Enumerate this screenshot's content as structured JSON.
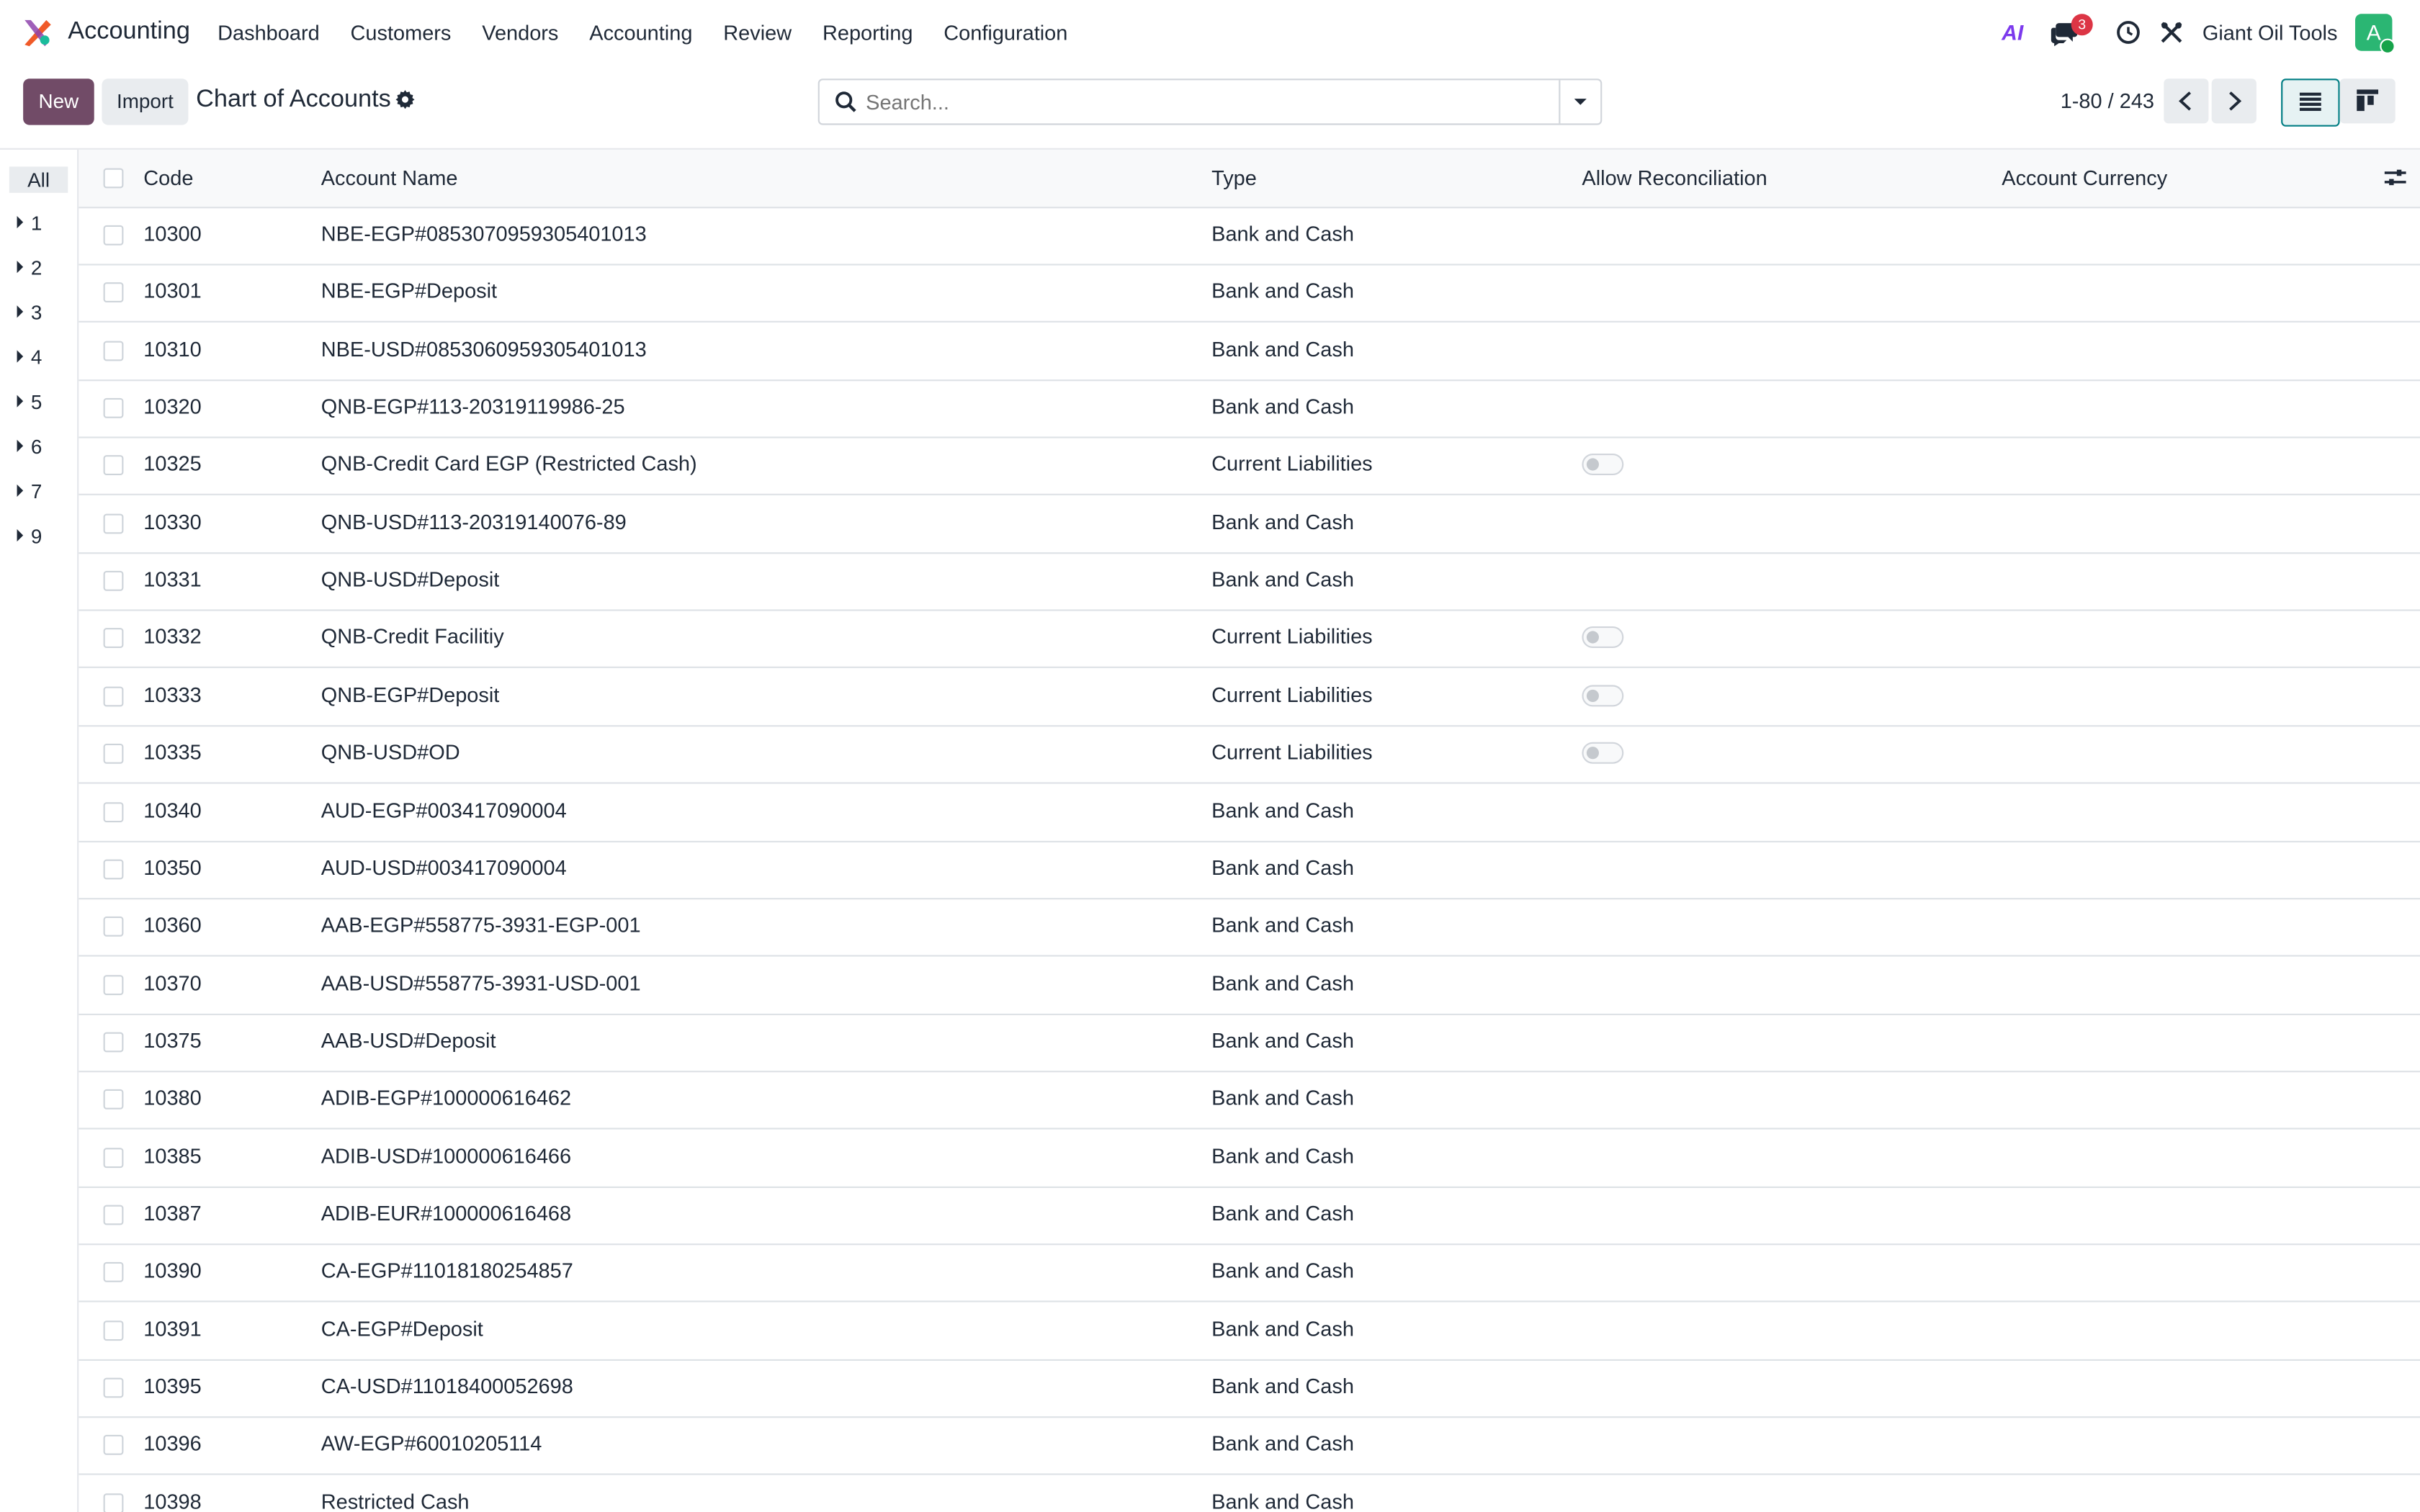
{
  "navbar": {
    "app_name": "Accounting",
    "menu": [
      "Dashboard",
      "Customers",
      "Vendors",
      "Accounting",
      "Review",
      "Reporting",
      "Configuration"
    ],
    "ai_label": "AI",
    "chat_badge": "3",
    "company": "Giant Oil Tools",
    "avatar_letter": "A"
  },
  "control": {
    "new_label": "New",
    "import_label": "Import",
    "title": "Chart of Accounts",
    "search_placeholder": "Search...",
    "pager": "1-80 / 243"
  },
  "sidebar": {
    "all": "All",
    "items": [
      "1",
      "2",
      "3",
      "4",
      "5",
      "6",
      "7",
      "9"
    ]
  },
  "table": {
    "columns": [
      "Code",
      "Account Name",
      "Type",
      "Allow Reconciliation",
      "Account Currency"
    ],
    "rows": [
      {
        "code": "10300",
        "name": "NBE-EGP#0853070959305401013",
        "type": "Bank and Cash",
        "reconcile": false
      },
      {
        "code": "10301",
        "name": "NBE-EGP#Deposit",
        "type": "Bank and Cash",
        "reconcile": false
      },
      {
        "code": "10310",
        "name": "NBE-USD#0853060959305401013",
        "type": "Bank and Cash",
        "reconcile": false
      },
      {
        "code": "10320",
        "name": "QNB-EGP#113-20319119986-25",
        "type": "Bank and Cash",
        "reconcile": false
      },
      {
        "code": "10325",
        "name": "QNB-Credit Card EGP (Restricted Cash)",
        "type": "Current Liabilities",
        "reconcile": true
      },
      {
        "code": "10330",
        "name": "QNB-USD#113-20319140076-89",
        "type": "Bank and Cash",
        "reconcile": false
      },
      {
        "code": "10331",
        "name": "QNB-USD#Deposit",
        "type": "Bank and Cash",
        "reconcile": false
      },
      {
        "code": "10332",
        "name": "QNB-Credit Facilitiy",
        "type": "Current Liabilities",
        "reconcile": true
      },
      {
        "code": "10333",
        "name": "QNB-EGP#Deposit",
        "type": "Current Liabilities",
        "reconcile": true
      },
      {
        "code": "10335",
        "name": "QNB-USD#OD",
        "type": "Current Liabilities",
        "reconcile": true
      },
      {
        "code": "10340",
        "name": "AUD-EGP#003417090004",
        "type": "Bank and Cash",
        "reconcile": false
      },
      {
        "code": "10350",
        "name": "AUD-USD#003417090004",
        "type": "Bank and Cash",
        "reconcile": false
      },
      {
        "code": "10360",
        "name": "AAB-EGP#558775-3931-EGP-001",
        "type": "Bank and Cash",
        "reconcile": false
      },
      {
        "code": "10370",
        "name": "AAB-USD#558775-3931-USD-001",
        "type": "Bank and Cash",
        "reconcile": false
      },
      {
        "code": "10375",
        "name": "AAB-USD#Deposit",
        "type": "Bank and Cash",
        "reconcile": false
      },
      {
        "code": "10380",
        "name": "ADIB-EGP#100000616462",
        "type": "Bank and Cash",
        "reconcile": false
      },
      {
        "code": "10385",
        "name": "ADIB-USD#100000616466",
        "type": "Bank and Cash",
        "reconcile": false
      },
      {
        "code": "10387",
        "name": "ADIB-EUR#100000616468",
        "type": "Bank and Cash",
        "reconcile": false
      },
      {
        "code": "10390",
        "name": "CA-EGP#11018180254857",
        "type": "Bank and Cash",
        "reconcile": false
      },
      {
        "code": "10391",
        "name": "CA-EGP#Deposit",
        "type": "Bank and Cash",
        "reconcile": false
      },
      {
        "code": "10395",
        "name": "CA-USD#11018400052698",
        "type": "Bank and Cash",
        "reconcile": false
      },
      {
        "code": "10396",
        "name": "AW-EGP#60010205114",
        "type": "Bank and Cash",
        "reconcile": false
      },
      {
        "code": "10398",
        "name": "Restricted Cash",
        "type": "Bank and Cash",
        "reconcile": false
      }
    ]
  },
  "colors": {
    "brand": "#714b67",
    "badge": "#dc3545",
    "avatar": "#2bb673"
  }
}
